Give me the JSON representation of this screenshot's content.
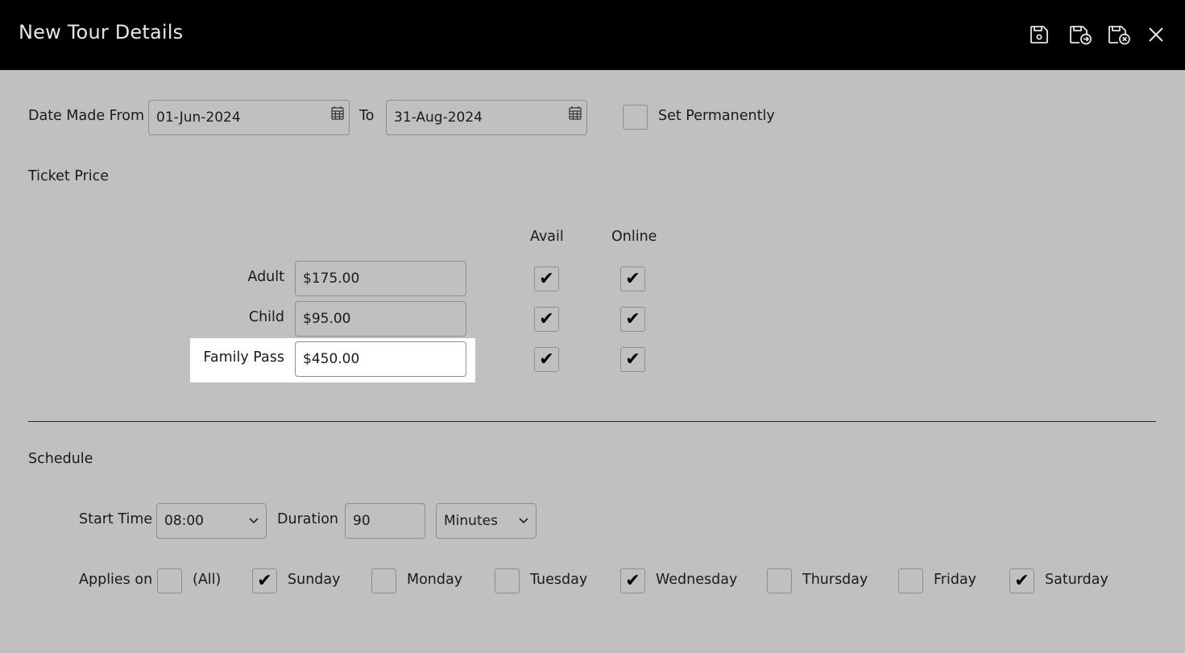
{
  "header": {
    "title": "New Tour Details",
    "icons": [
      "save-icon",
      "save-and-new-icon",
      "save-and-close-icon",
      "close-icon"
    ]
  },
  "dates": {
    "from_label": "Date Made From",
    "from_value": "01-Jun-2024",
    "to_label": "To",
    "to_value": "31-Aug-2024",
    "set_permanently_label": "Set Permanently",
    "set_permanently_checked": false
  },
  "ticket_price": {
    "section_label": "Ticket Price",
    "col_avail": "Avail",
    "col_online": "Online",
    "rows": [
      {
        "label": "Adult",
        "price": "$175.00",
        "avail": true,
        "online": true
      },
      {
        "label": "Child",
        "price": "$95.00",
        "avail": true,
        "online": true
      },
      {
        "label": "Family Pass",
        "price": "$450.00",
        "avail": true,
        "online": true
      }
    ]
  },
  "schedule": {
    "section_label": "Schedule",
    "start_time_label": "Start Time",
    "start_time_value": "08:00",
    "duration_label": "Duration",
    "duration_value": "90",
    "duration_unit": "Minutes",
    "applies_on_label": "Applies on",
    "days": [
      {
        "label": "(All)",
        "checked": false
      },
      {
        "label": "Sunday",
        "checked": true
      },
      {
        "label": "Monday",
        "checked": false
      },
      {
        "label": "Tuesday",
        "checked": false
      },
      {
        "label": "Wednesday",
        "checked": true
      },
      {
        "label": "Thursday",
        "checked": false
      },
      {
        "label": "Friday",
        "checked": false
      },
      {
        "label": "Saturday",
        "checked": true
      }
    ]
  },
  "colors": {
    "header_bg": "#000000",
    "body_bg": "#c0c0c0",
    "highlight": "#ffffff"
  }
}
